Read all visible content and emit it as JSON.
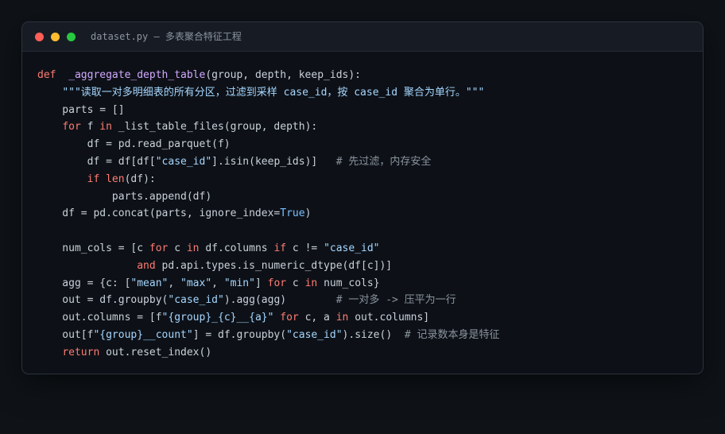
{
  "window": {
    "title": "dataset.py — 多表聚合特征工程"
  },
  "code": {
    "language": "python",
    "lines": [
      [
        [
          "kw",
          "def"
        ],
        [
          "",
          "  "
        ],
        [
          "fn",
          "_aggregate_depth_table"
        ],
        [
          "",
          "(group, depth, keep_ids):"
        ]
      ],
      [
        [
          "",
          "    "
        ],
        [
          "str",
          "\"\"\"读取一对多明细表的所有分区，过滤到采样 case_id，按 case_id 聚合为单行。\"\"\""
        ]
      ],
      [
        [
          "",
          "    parts = []"
        ]
      ],
      [
        [
          "",
          "    "
        ],
        [
          "kw",
          "for"
        ],
        [
          "",
          " f "
        ],
        [
          "kw",
          "in"
        ],
        [
          "",
          " _list_table_files(group, depth):"
        ]
      ],
      [
        [
          "",
          "        df = pd.read_parquet(f)"
        ]
      ],
      [
        [
          "",
          "        df = df[df["
        ],
        [
          "str",
          "\"case_id\""
        ],
        [
          "",
          "].isin(keep_ids)]   "
        ],
        [
          "cm",
          "# 先过滤，内存安全"
        ]
      ],
      [
        [
          "",
          "        "
        ],
        [
          "kw",
          "if"
        ],
        [
          "",
          " "
        ],
        [
          "kw",
          "len"
        ],
        [
          "",
          "(df):"
        ]
      ],
      [
        [
          "",
          "            parts.append(df)"
        ]
      ],
      [
        [
          "",
          "    df = pd.concat(parts, ignore_index="
        ],
        [
          "cn",
          "True"
        ],
        [
          "",
          ")"
        ]
      ],
      [],
      [
        [
          "",
          "    num_cols = [c "
        ],
        [
          "kw",
          "for"
        ],
        [
          "",
          " c "
        ],
        [
          "kw",
          "in"
        ],
        [
          "",
          " df.columns "
        ],
        [
          "kw",
          "if"
        ],
        [
          "",
          " c != "
        ],
        [
          "str",
          "\"case_id\""
        ]
      ],
      [
        [
          "",
          "                "
        ],
        [
          "kw",
          "and"
        ],
        [
          "",
          " pd.api.types.is_numeric_dtype(df[c])]"
        ]
      ],
      [
        [
          "",
          "    agg = {c: ["
        ],
        [
          "str",
          "\"mean\""
        ],
        [
          "",
          ", "
        ],
        [
          "str",
          "\"max\""
        ],
        [
          "",
          ", "
        ],
        [
          "str",
          "\"min\""
        ],
        [
          "",
          "] "
        ],
        [
          "kw",
          "for"
        ],
        [
          "",
          " c "
        ],
        [
          "kw",
          "in"
        ],
        [
          "",
          " num_cols}"
        ]
      ],
      [
        [
          "",
          "    out = df.groupby("
        ],
        [
          "str",
          "\"case_id\""
        ],
        [
          "",
          ").agg(agg)        "
        ],
        [
          "cm",
          "# 一对多 -> 压平为一行"
        ]
      ],
      [
        [
          "",
          "    out.columns = [f"
        ],
        [
          "str",
          "\"{group}_{c}__{a}\""
        ],
        [
          "",
          " "
        ],
        [
          "kw",
          "for"
        ],
        [
          "",
          " c, a "
        ],
        [
          "kw",
          "in"
        ],
        [
          "",
          " out.columns]"
        ]
      ],
      [
        [
          "",
          "    out[f"
        ],
        [
          "str",
          "\"{group}__count\""
        ],
        [
          "",
          "] = df.groupby("
        ],
        [
          "str",
          "\"case_id\""
        ],
        [
          "",
          ").size()  "
        ],
        [
          "cm",
          "# 记录数本身是特征"
        ]
      ],
      [
        [
          "",
          "    "
        ],
        [
          "kw",
          "return"
        ],
        [
          "",
          " out.reset_index()"
        ]
      ]
    ]
  },
  "colors": {
    "keyword": "#ff7b72",
    "function": "#d2a8ff",
    "string": "#a5d6ff",
    "comment": "#8b949e",
    "constant": "#79c0ff",
    "text": "#c9d1d9",
    "background": "#0d1117",
    "page_background": "#0f1318"
  }
}
